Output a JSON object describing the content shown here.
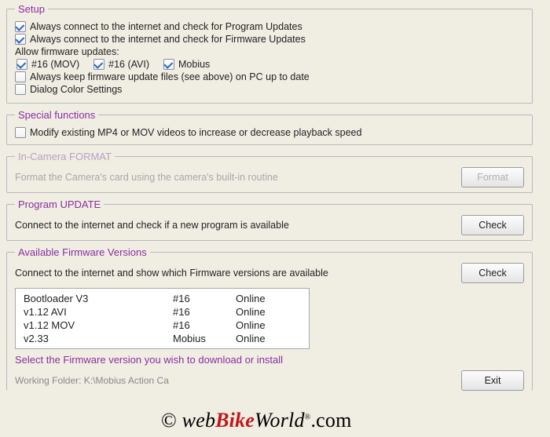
{
  "setup": {
    "legend": "Setup",
    "chk_program_updates": "Always connect to the internet and check for Program Updates",
    "chk_firmware_updates": "Always connect to the internet and check for Firmware Updates",
    "allow_fw_label": "Allow firmware updates:",
    "chk_16_mov": "#16 (MOV)",
    "chk_16_avi": "#16 (AVI)",
    "chk_mobius": "Mobius",
    "chk_keep_fw_files": "Always keep firmware update files (see above) on PC up to date",
    "chk_dialog_color": "Dialog Color Settings"
  },
  "special": {
    "legend": "Special functions",
    "chk_modify_mp4": "Modify existing MP4 or MOV videos to increase or decrease playback speed"
  },
  "format": {
    "legend": "In-Camera FORMAT",
    "desc": "Format the Camera's card using the camera's built-in routine",
    "btn": "Format"
  },
  "program_update": {
    "legend": "Program UPDATE",
    "desc": "Connect to the internet and check if a new program is available",
    "btn": "Check"
  },
  "firmware": {
    "legend": "Available Firmware Versions",
    "desc": "Connect to the internet and show which Firmware versions are available",
    "btn": "Check",
    "rows": [
      {
        "name": "Bootloader V3",
        "id": "#16",
        "status": "Online"
      },
      {
        "name": "v1.12 AVI",
        "id": "#16",
        "status": "Online"
      },
      {
        "name": "v1.12 MOV",
        "id": "#16",
        "status": "Online"
      },
      {
        "name": "v2.33",
        "id": "Mobius",
        "status": "Online"
      }
    ],
    "prompt": "Select the Firmware version you wish to download or install"
  },
  "footer": {
    "working_folder": "Working Folder: K:\\Mobius Action Ca",
    "exit_btn": "Exit"
  },
  "watermark": {
    "copy": "© ",
    "web": "web",
    "bike": "Bike",
    "world": "World",
    "reg": "®",
    "dotcom": ".com"
  }
}
